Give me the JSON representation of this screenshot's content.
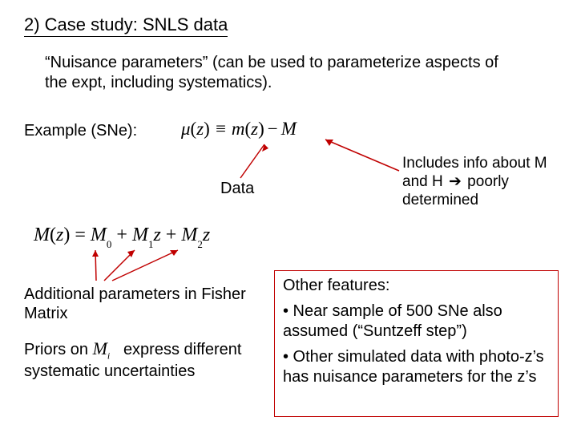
{
  "title": "2) Case study: SNLS data",
  "nuisance_text": "“Nuisance parameters” (can be used to parameterize aspects of the expt, including systematics).",
  "example_label": "Example (SNe):",
  "eq_mu_html": "μ<span class='paren'>(</span>z<span class='paren'>)</span> ≡ m<span class='paren'>(</span>z<span class='paren'>)</span><span class='minus'>−</span>M",
  "data_label": "Data",
  "includes_html": "Includes info about M and H <span class='arrow-glyph'>➔</span> poorly determined",
  "eq_M_html": "M<span class='paren'>(</span>z<span class='paren'>)</span> <span class='eq'>=</span> M<sub>0</sub> <span class='plus'>+</span> M<sub>1</sub>z <span class='plus'>+</span> M<sub>2</sub>z",
  "additional_params": "Additional parameters in Fisher Matrix",
  "priors_prefix": "Priors on ",
  "priors_symbol_html": "M<sub>i</sub>",
  "priors_suffix": " express different systematic uncertainties",
  "features": {
    "heading": "Other features:",
    "bullet1": "• Near sample of 500 SNe also assumed (“Suntzeff step”)",
    "bullet2": "• Other simulated data with photo-z’s has nuisance parameters for the z’s"
  }
}
